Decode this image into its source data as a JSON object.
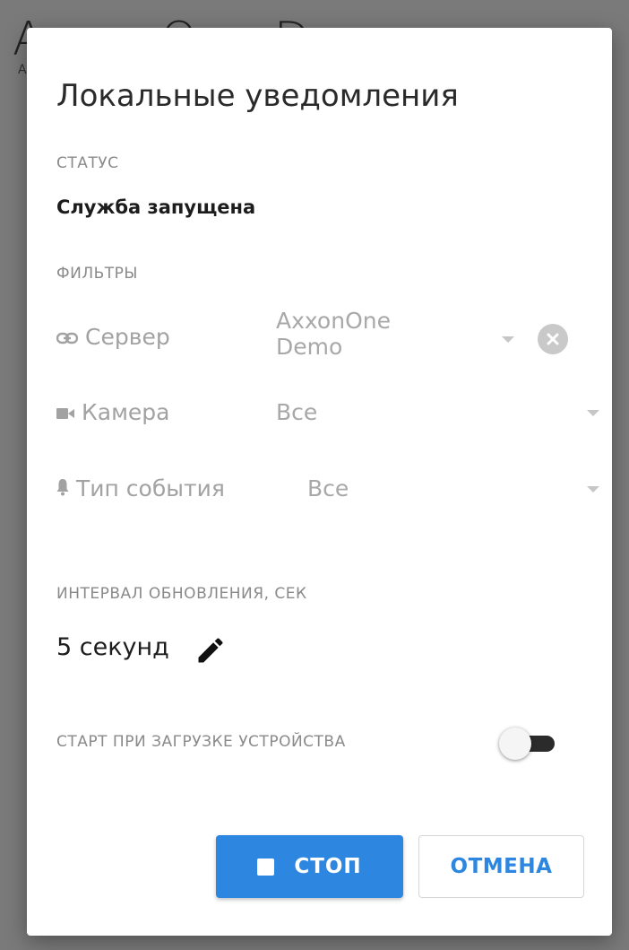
{
  "background": {
    "title": "AxxonOne Demo",
    "subtitle": "A"
  },
  "dialog": {
    "title": "Локальные уведомления",
    "status": {
      "label": "СТАТУС",
      "value": "Служба запущена"
    },
    "filters": {
      "label": "ФИЛЬТРЫ",
      "server": {
        "label": "Сервер",
        "value": "AxxonOne Demo",
        "icon": "link-icon"
      },
      "camera": {
        "label": "Камера",
        "value": "Все",
        "icon": "camera-icon"
      },
      "event_type": {
        "label": "Тип события",
        "value": "Все",
        "icon": "bell-icon"
      }
    },
    "interval": {
      "label": "ИНТЕРВАЛ ОБНОВЛЕНИЯ, СЕК",
      "value": "5 секунд"
    },
    "autostart": {
      "label": "СТАРТ ПРИ ЗАГРУЗКЕ УСТРОЙСТВА",
      "enabled": false
    },
    "buttons": {
      "stop": "СТОП",
      "cancel": "ОТМЕНА"
    }
  },
  "colors": {
    "accent": "#2d86e0",
    "overlay": "#6b6b6b",
    "muted_text": "#a2a2a2"
  }
}
